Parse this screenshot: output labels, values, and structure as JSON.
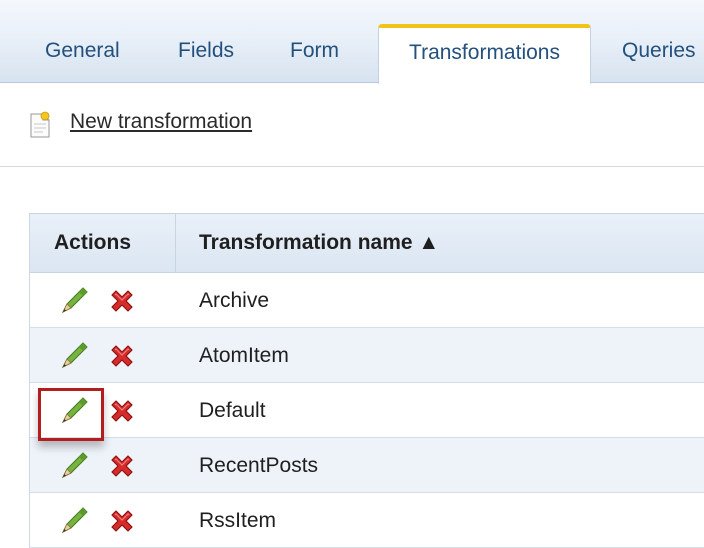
{
  "tabs": [
    {
      "label": "General",
      "active": false
    },
    {
      "label": "Fields",
      "active": false
    },
    {
      "label": "Form",
      "active": false
    },
    {
      "label": "Transformations",
      "active": true
    },
    {
      "label": "Queries",
      "active": false
    }
  ],
  "toolbar": {
    "new_transformation_label": "New transformation",
    "new_icon": "new-document-icon"
  },
  "grid": {
    "columns": [
      "Actions",
      "Transformation name ▲"
    ],
    "sort_indicator": "ascending",
    "rows": [
      {
        "name": "Archive",
        "actions": [
          "edit-pencil-icon",
          "delete-x-icon"
        ]
      },
      {
        "name": "AtomItem",
        "actions": [
          "edit-pencil-icon",
          "delete-x-icon"
        ]
      },
      {
        "name": "Default",
        "actions": [
          "edit-pencil-icon",
          "delete-x-icon"
        ],
        "highlighted_action": "edit"
      },
      {
        "name": "RecentPosts",
        "actions": [
          "edit-pencil-icon",
          "delete-x-icon"
        ]
      },
      {
        "name": "RssItem",
        "actions": [
          "edit-pencil-icon",
          "delete-x-icon"
        ]
      }
    ]
  },
  "colors": {
    "active_tab_accent": "#f0c419",
    "tab_text": "#24507d",
    "highlight_box": "#b21e1e",
    "alt_row": "#eef3f9"
  }
}
